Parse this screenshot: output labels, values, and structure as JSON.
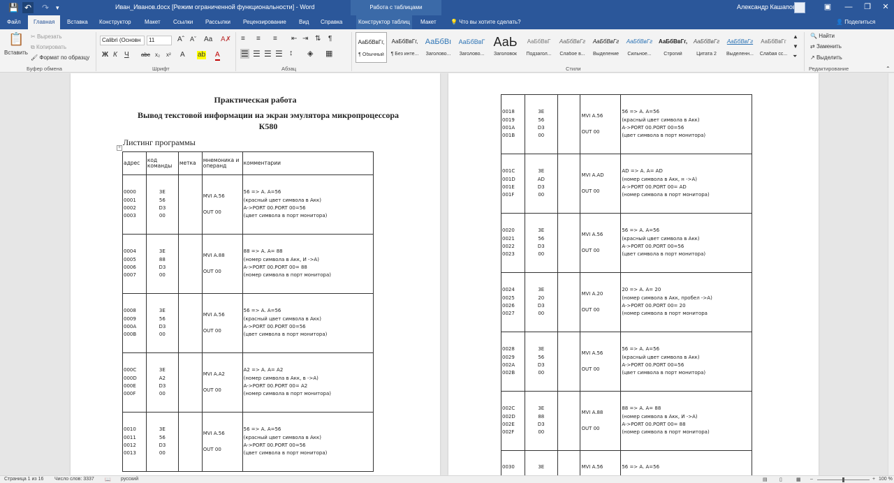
{
  "titlebar": {
    "doc_title": "Иван_Иванов.docx [Режим ограниченной функциональности]  -  Word",
    "table_tools": "Работа с таблицами",
    "user_name": "Александр Кашапов"
  },
  "tabs": [
    {
      "label": "Файл"
    },
    {
      "label": "Главная"
    },
    {
      "label": "Вставка"
    },
    {
      "label": "Конструктор"
    },
    {
      "label": "Макет"
    },
    {
      "label": "Ссылки"
    },
    {
      "label": "Рассылки"
    },
    {
      "label": "Рецензирование"
    },
    {
      "label": "Вид"
    },
    {
      "label": "Справка"
    },
    {
      "label": "Конструктор таблиц"
    },
    {
      "label": "Макет"
    }
  ],
  "tell_me": "Что вы хотите сделать?",
  "share": "Поделиться",
  "clipboard": {
    "paste": "Вставить",
    "cut": "Вырезать",
    "copy": "Копировать",
    "format_painter": "Формат по образцу",
    "label": "Буфер обмена"
  },
  "font": {
    "name": "Calibri (Основн",
    "size": "11",
    "label": "Шрифт"
  },
  "paragraph": {
    "label": "Абзац"
  },
  "styles": {
    "label": "Стили",
    "items": [
      {
        "preview": "АаБбВвГг,",
        "name": "¶ Обычный"
      },
      {
        "preview": "АаБбВвГг,",
        "name": "¶ Без инте..."
      },
      {
        "preview": "АаБбВı",
        "name": "Заголово..."
      },
      {
        "preview": "АаБбВвГ",
        "name": "Заголово..."
      },
      {
        "preview": "АаЬ",
        "name": "Заголовок"
      },
      {
        "preview": "АаБбВвГ",
        "name": "Подзагол..."
      },
      {
        "preview": "АаБбВвГг",
        "name": "Слабое в..."
      },
      {
        "preview": "АаБбВвГг",
        "name": "Выделение"
      },
      {
        "preview": "АаБбВвГг",
        "name": "Сильное..."
      },
      {
        "preview": "АаБбВвГг,",
        "name": "Строгий"
      },
      {
        "preview": "АаБбВвГг",
        "name": "Цитата 2"
      },
      {
        "preview": "АаБбВвГг",
        "name": "Выделенн..."
      },
      {
        "preview": "АаБбВвГг",
        "name": "Слабая сс..."
      }
    ]
  },
  "editing": {
    "find": "Найти",
    "replace": "Заменить",
    "select": "Выделить",
    "label": "Редактирование"
  },
  "document": {
    "heading1": "Практическая работа",
    "heading2_line1": "Вывод текстовой информации на экран эмулятора микропроцессора",
    "heading2_line2": "К580",
    "listing_title": "Листинг программы",
    "table_headers": {
      "address": "адрес",
      "code": "код команды",
      "label": "метка",
      "mnemonic": "мнемоника и операнд",
      "comment": "комментарии"
    },
    "rows_page1": [
      {
        "addr": "0000\n0001\n0002\n0003",
        "code": "3E\n56\nD3\n00",
        "mnem": "MVI A.56\n\nOUT 00",
        "comm": "56 => A. A=56\n(красный цвет символа в Акк)\nA->PORT 00.PORT 00=56\n(цвет символа в порт монитора)"
      },
      {
        "addr": "0004\n0005\n0006\n0007",
        "code": "3E\n88\nD3\n00",
        "mnem": "MVI A.88\n\nOUT 00",
        "comm": "88 => A. A= 88\n(номер символа в Акк, И ->A)\nA->PORT 00.PORT 00= 88\n(номер символа в порт монитора)"
      },
      {
        "addr": "0008\n0009\n000A\n000B",
        "code": "3E\n56\nD3\n00",
        "mnem": "MVI A.56\n\nOUT 00",
        "comm": "56 => A. A=56\n(красный цвет символа в Акк)\nA->PORT 00.PORT 00=56\n(цвет символа в порт монитора)"
      },
      {
        "addr": "000C\n000D\n000E\n000F",
        "code": "3E\nA2\nD3\n00",
        "mnem": "MVI A.A2\n\nOUT 00",
        "comm": "A2 => A. A= A2\n(номер символа в Акк, в ->A)\nA->PORT 00.PORT 00= A2\n(номер символа в порт монитора)"
      },
      {
        "addr": "0010\n0011\n0012\n0013",
        "code": "3E\n56\nD3\n00",
        "mnem": "MVI A.56\n\nOUT 00",
        "comm": "56 => A. A=56\n(красный цвет символа в Акк)\nA->PORT 00.PORT 00=56\n(цвет символа в порт монитора)"
      }
    ],
    "rows_page2": [
      {
        "addr": "0018\n0019\n001A\n001B",
        "code": "3E\n56\nD3\n00",
        "mnem": "MVI A.56\n\nOUT 00",
        "comm": "56 => A. A=56\n(красный цвет символа в Акк)\nA->PORT 00.PORT 00=56\n(цвет символа в порт монитора)"
      },
      {
        "addr": "001C\n001D\n001E\n001F",
        "code": "3E\nAD\nD3\n00",
        "mnem": "MVI A.AD\n\nOUT 00",
        "comm": "AD => A. A= AD\n(номер символа в Акк, н ->A)\nA->PORT 00.PORT 00= AD\n(номер символа в порт монитора)"
      },
      {
        "addr": "0020\n0021\n0022\n0023",
        "code": "3E\n56\nD3\n00",
        "mnem": "MVI A.56\n\nOUT 00",
        "comm": "56 => A. A=56\n(красный цвет символа в Акк)\nA->PORT 00.PORT 00=56\n(цвет символа в порт монитора)"
      },
      {
        "addr": "0024\n0025\n0026\n0027",
        "code": "3E\n20\nD3\n00",
        "mnem": "MVI A.20\n\nOUT 00",
        "comm": "20 => A. A= 20\n(номер символа в Акк, пробел ->A)\nA->PORT 00.PORT 00= 20\n(номер символа в порт монитора"
      },
      {
        "addr": "0028\n0029\n002A\n002B",
        "code": "3E\n56\nD3\n00",
        "mnem": "MVI A.56\n\nOUT 00",
        "comm": "56 => A. A=56\n(красный цвет символа в Акк)\nA->PORT 00.PORT 00=56\n(цвет символа в порт монитора)"
      },
      {
        "addr": "002C\n002D\n002E\n002F",
        "code": "3E\n88\nD3\n00",
        "mnem": "MVI A.88\n\nOUT 00",
        "comm": "88 => A. A= 88\n(номер символа в Акк, И ->A)\nA->PORT 00.PORT 00= 88\n(номер символа в порт монитора)"
      },
      {
        "addr": "0030",
        "code": "3E",
        "mnem": "MVI A.56",
        "comm": "56 => A. A=56"
      }
    ]
  },
  "statusbar": {
    "page": "Страница 1 из 16",
    "words": "Число слов: 3337",
    "language": "русский",
    "zoom": "100 %"
  },
  "colors": {
    "accent": "#2b579a",
    "ribbon_bg": "#f3f3f3",
    "workspace_bg": "#e6e6e6"
  }
}
